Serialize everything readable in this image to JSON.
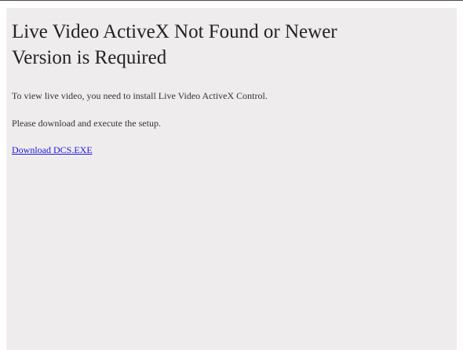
{
  "page": {
    "title": "Live Video ActiveX Not Found or Newer Version is Required",
    "instruction_1": "To view live video, you need to install Live Video ActiveX Control.",
    "instruction_2": "Please download and execute the setup.",
    "download_link_label": "Download DCS.EXE"
  },
  "colors": {
    "background": "#efecee",
    "link": "#1a1ad6",
    "text": "#222222"
  }
}
